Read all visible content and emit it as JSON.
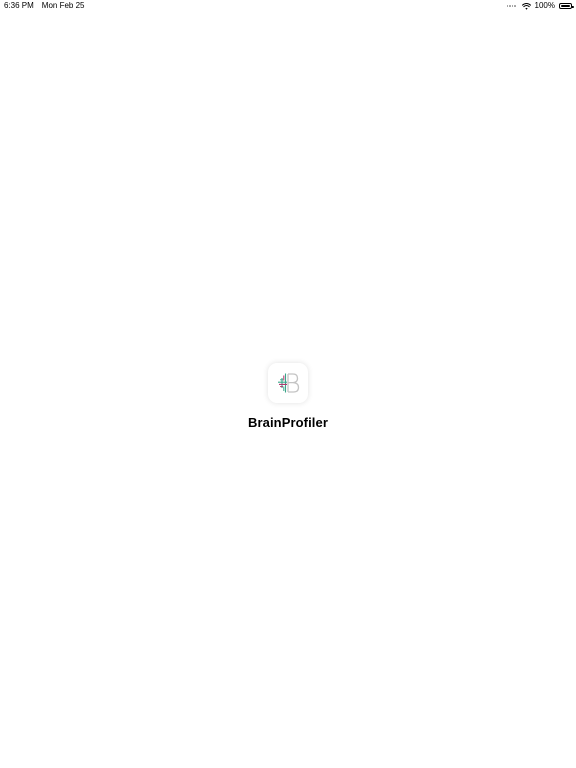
{
  "status_bar": {
    "time": "6:36 PM",
    "date": "Mon Feb 25",
    "battery_text": "100%",
    "battery_level": 1.0
  },
  "app": {
    "name": "BrainProfiler",
    "icon": "brainprofiler-logo-icon"
  },
  "colors": {
    "background": "#ffffff",
    "logo_green": "#3aa68a",
    "logo_magenta": "#b0306a",
    "logo_gray": "#b8b8b8"
  }
}
